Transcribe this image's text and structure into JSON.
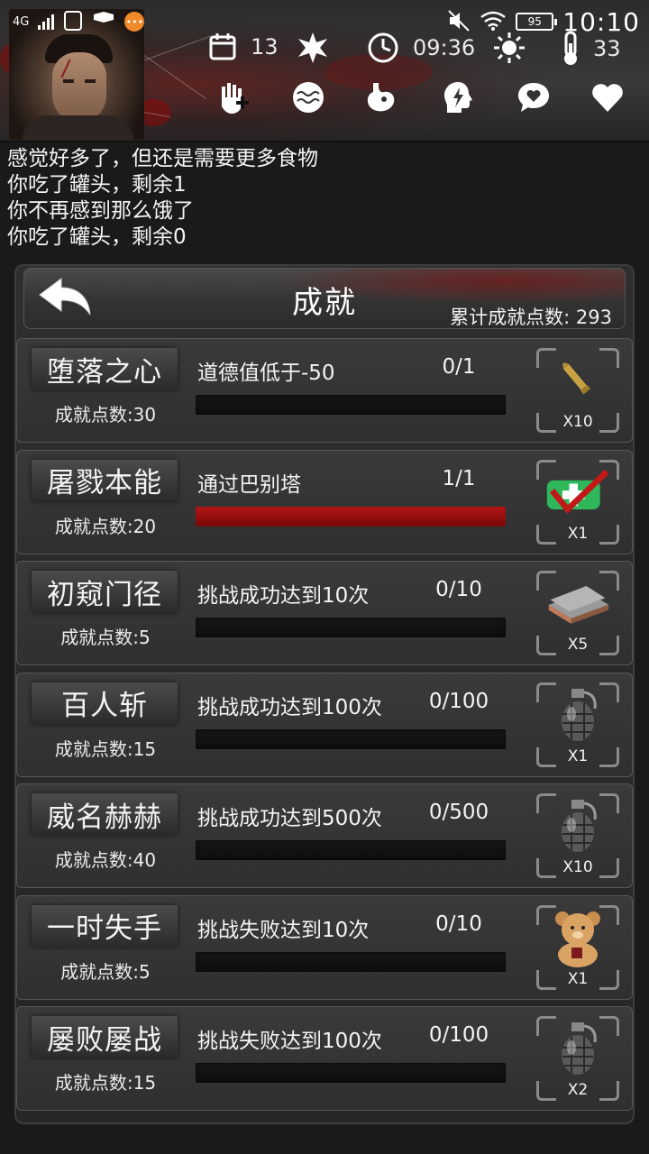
{
  "status_bar": {
    "network": "4G",
    "time": "10:10",
    "battery": "95"
  },
  "hud": {
    "days": "13",
    "clock": "09:36",
    "temperature": "33",
    "status_icons": [
      "hand-bandage-icon",
      "brain-icon",
      "stomach-icon",
      "head-energy-icon",
      "speech-heart-icon",
      "heart-icon"
    ]
  },
  "log": [
    "感觉好多了，但还是需要更多食物",
    "你吃了罐头，剩余1",
    "你不再感到那么饿了",
    "你吃了罐头，剩余0"
  ],
  "dialog": {
    "title": "成就",
    "total_points": "累计成就点数: 293",
    "back_icon": "back-arrow-icon"
  },
  "achievements": [
    {
      "name": "堕落之心",
      "points": "成就点数:30",
      "desc": "道德值低于-50",
      "progress": "0/1",
      "fill": 0,
      "reward": "bullet",
      "qty": "X10"
    },
    {
      "name": "屠戮本能",
      "points": "成就点数:20",
      "desc": "通过巴别塔",
      "progress": "1/1",
      "fill": 1,
      "reward": "medkit",
      "qty": "X1"
    },
    {
      "name": "初窥门径",
      "points": "成就点数:5",
      "desc": "挑战成功达到10次",
      "progress": "0/10",
      "fill": 0,
      "reward": "plates",
      "qty": "X5"
    },
    {
      "name": "百人斩",
      "points": "成就点数:15",
      "desc": "挑战成功达到100次",
      "progress": "0/100",
      "fill": 0,
      "reward": "grenade",
      "qty": "X1"
    },
    {
      "name": "威名赫赫",
      "points": "成就点数:40",
      "desc": "挑战成功达到500次",
      "progress": "0/500",
      "fill": 0,
      "reward": "grenade",
      "qty": "X10"
    },
    {
      "name": "一时失手",
      "points": "成就点数:5",
      "desc": "挑战失败达到10次",
      "progress": "0/10",
      "fill": 0,
      "reward": "teddy-bear",
      "qty": "X1"
    },
    {
      "name": "屡败屡战",
      "points": "成就点数:15",
      "desc": "挑战失败达到100次",
      "progress": "0/100",
      "fill": 0,
      "reward": "grenade",
      "qty": "X2"
    }
  ]
}
